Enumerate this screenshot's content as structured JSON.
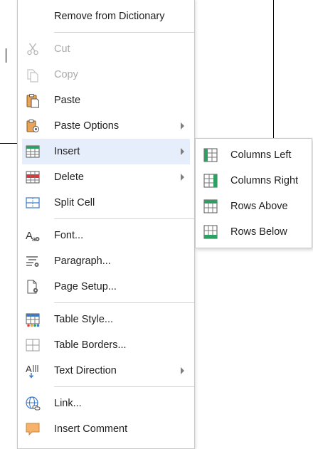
{
  "context_menu": {
    "items": [
      {
        "label": "Remove from Dictionary"
      },
      {
        "label": "Cut",
        "icon": "scissors-icon"
      },
      {
        "label": "Copy",
        "icon": "copy-icon"
      },
      {
        "label": "Paste",
        "icon": "paste-icon"
      },
      {
        "label": "Paste Options",
        "icon": "paste-options-icon"
      },
      {
        "label": "Insert",
        "icon": "insert-table-icon"
      },
      {
        "label": "Delete",
        "icon": "delete-table-icon"
      },
      {
        "label": "Split Cell",
        "icon": "split-cell-icon"
      },
      {
        "label": "Font...",
        "icon": "font-icon"
      },
      {
        "label": "Paragraph...",
        "icon": "paragraph-icon"
      },
      {
        "label": "Page Setup...",
        "icon": "page-setup-icon"
      },
      {
        "label": "Table Style...",
        "icon": "table-style-icon"
      },
      {
        "label": "Table Borders...",
        "icon": "table-borders-icon"
      },
      {
        "label": "Text Direction",
        "icon": "text-direction-icon"
      },
      {
        "label": "Link...",
        "icon": "link-icon"
      },
      {
        "label": "Insert Comment",
        "icon": "comment-icon"
      }
    ]
  },
  "insert_submenu": {
    "items": [
      {
        "label": "Columns Left",
        "icon": "columns-left-icon"
      },
      {
        "label": "Columns Right",
        "icon": "columns-right-icon"
      },
      {
        "label": "Rows Above",
        "icon": "rows-above-icon"
      },
      {
        "label": "Rows Below",
        "icon": "rows-below-icon"
      }
    ]
  },
  "colors": {
    "highlight": "#e5eefa",
    "accent_green": "#2e9e62",
    "accent_red": "#d9363e",
    "disabled_text": "#aaaaaa"
  }
}
